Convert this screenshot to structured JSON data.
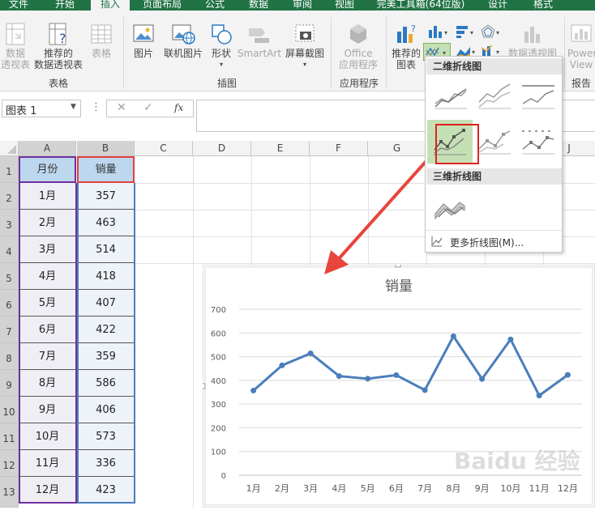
{
  "tabs": [
    {
      "label": "文件",
      "active": false
    },
    {
      "label": "开始",
      "active": false
    },
    {
      "label": "插入",
      "active": true
    },
    {
      "label": "页面布局",
      "active": false
    },
    {
      "label": "公式",
      "active": false
    },
    {
      "label": "数据",
      "active": false
    },
    {
      "label": "审阅",
      "active": false
    },
    {
      "label": "视图",
      "active": false
    },
    {
      "label": "完美工具箱(64位版)",
      "active": false
    },
    {
      "label": "设计",
      "active": false
    },
    {
      "label": "格式",
      "active": false
    }
  ],
  "ribbon": {
    "pivot": {
      "line1": "数据",
      "line2": "透视表"
    },
    "recommended_pivot": {
      "line1": "推荐的",
      "line2": "数据透视表"
    },
    "table": "表格",
    "group_tables": "表格",
    "picture": "图片",
    "online_picture": "联机图片",
    "shapes": "形状",
    "smartart": "SmartArt",
    "screenshot": "屏幕截图",
    "group_illustrations": "插图",
    "office_apps": {
      "line1": "Office",
      "line2": "应用程序"
    },
    "group_apps": "应用程序",
    "recommended_charts": {
      "line1": "推荐的",
      "line2": "图表"
    },
    "pivot_chart": "数据透视图",
    "power_view": {
      "line1": "Power",
      "line2": "View"
    },
    "group_reports": "报告"
  },
  "formula_bar": {
    "name_box": "图表 1",
    "fx": "fx",
    "value": ""
  },
  "columns": [
    "A",
    "B",
    "C",
    "D",
    "E",
    "F",
    "G",
    "H",
    "I",
    "J"
  ],
  "rows": [
    "1",
    "2",
    "3",
    "4",
    "5",
    "6",
    "7",
    "8",
    "9",
    "10",
    "11",
    "12",
    "13"
  ],
  "table": {
    "header": {
      "month": "月份",
      "sales": "销量"
    },
    "rows": [
      {
        "month": "1月",
        "sales": "357"
      },
      {
        "month": "2月",
        "sales": "463"
      },
      {
        "month": "3月",
        "sales": "514"
      },
      {
        "month": "4月",
        "sales": "418"
      },
      {
        "month": "5月",
        "sales": "407"
      },
      {
        "month": "6月",
        "sales": "422"
      },
      {
        "month": "7月",
        "sales": "359"
      },
      {
        "month": "8月",
        "sales": "586"
      },
      {
        "month": "9月",
        "sales": "406"
      },
      {
        "month": "10月",
        "sales": "573"
      },
      {
        "month": "11月",
        "sales": "336"
      },
      {
        "month": "12月",
        "sales": "423"
      }
    ]
  },
  "dropdown": {
    "section_2d": "二维折线图",
    "section_3d": "三维折线图",
    "more": "更多折线图(M)..."
  },
  "colors": {
    "excel_green": "#217346",
    "line_blue": "#4a7ebb",
    "highlight_red": "#e02020",
    "arrow_red": "#e8453c"
  },
  "chart_data": {
    "type": "line",
    "title": "销量",
    "categories": [
      "1月",
      "2月",
      "3月",
      "4月",
      "5月",
      "6月",
      "7月",
      "8月",
      "9月",
      "10月",
      "11月",
      "12月"
    ],
    "values": [
      357,
      463,
      514,
      418,
      407,
      422,
      359,
      586,
      406,
      573,
      336,
      423
    ],
    "ylim": [
      0,
      700
    ],
    "yticks": [
      0,
      100,
      200,
      300,
      400,
      500,
      600,
      700
    ],
    "grid": true,
    "markers": true
  },
  "watermark": "Baidu 经验"
}
